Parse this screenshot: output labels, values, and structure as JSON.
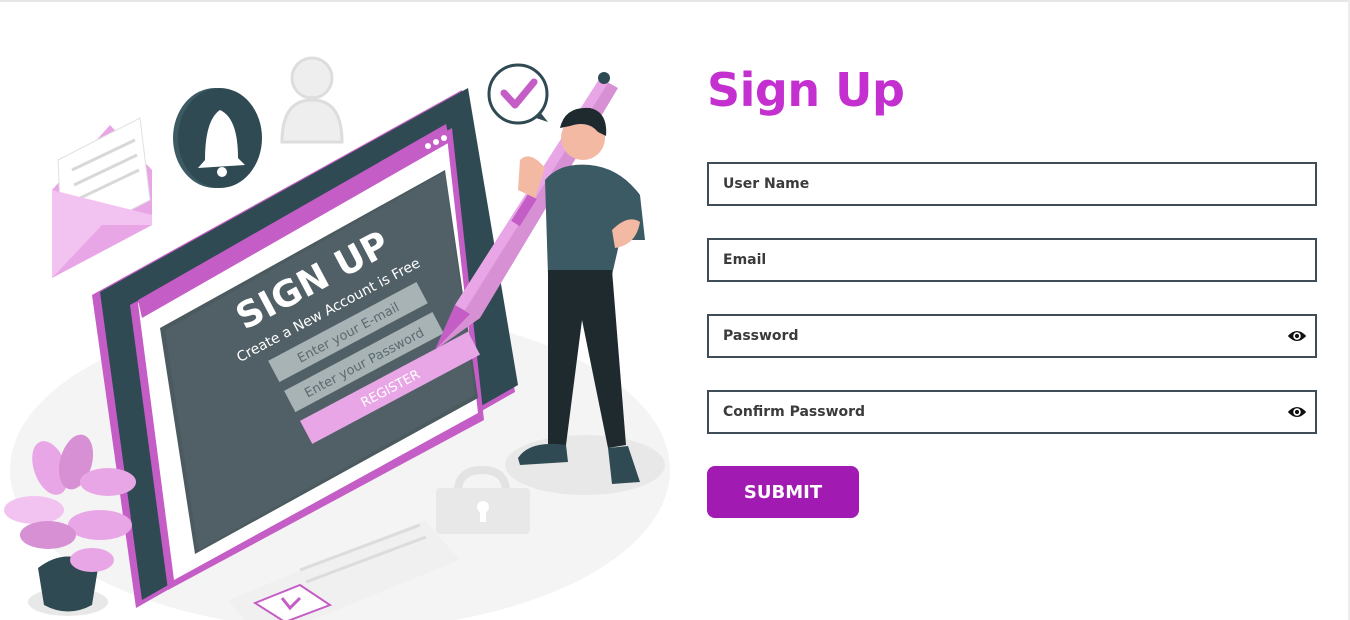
{
  "form": {
    "title": "Sign Up",
    "fields": [
      {
        "placeholder": "User Name",
        "value": ""
      },
      {
        "placeholder": "Email",
        "value": ""
      },
      {
        "placeholder": "Password",
        "value": ""
      },
      {
        "placeholder": "Confirm Password",
        "value": ""
      }
    ],
    "submit_label": "SUBMIT"
  },
  "illustration": {
    "heading": "SIGN UP",
    "subheading": "Create a New Account is Free",
    "email_field": "Enter your E-mail",
    "password_field": "Enter your Password",
    "button": "REGISTER"
  },
  "colors": {
    "accent": "#c42fd0",
    "button": "#a11ab2",
    "border": "#3e4d57"
  },
  "icons": [
    "envelope-icon",
    "bell-icon",
    "user-icon",
    "check-icon",
    "lock-icon",
    "eye-icon"
  ]
}
